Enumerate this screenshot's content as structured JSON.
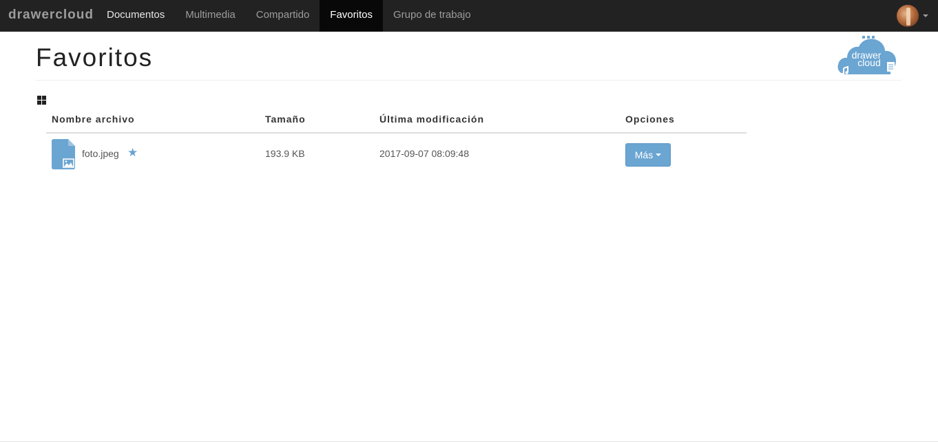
{
  "navbar": {
    "brand": "drawercloud",
    "items": [
      {
        "label": "Documentos"
      },
      {
        "label": "Multimedia"
      },
      {
        "label": "Compartido"
      },
      {
        "label": "Favoritos"
      },
      {
        "label": "Grupo de trabajo"
      }
    ],
    "active": "Favoritos"
  },
  "header": {
    "title": "Favoritos",
    "logo_line1": "drawer",
    "logo_line2": "cloud"
  },
  "icons": {
    "grid": "grid-view-icon",
    "file": "image-file-icon",
    "favorite": "star-icon",
    "user": "avatar"
  },
  "colors": {
    "navbar_bg": "#222222",
    "accent": "#6ba5d2"
  },
  "table": {
    "headers": {
      "name": "Nombre archivo",
      "size": "Tamaño",
      "modified": "Última modificación",
      "options": "Opciones"
    },
    "rows": [
      {
        "name": "foto.jpeg",
        "favorite": "★",
        "size": "193.9 KB",
        "modified": "2017-09-07 08:09:48",
        "action": "Más"
      }
    ]
  }
}
